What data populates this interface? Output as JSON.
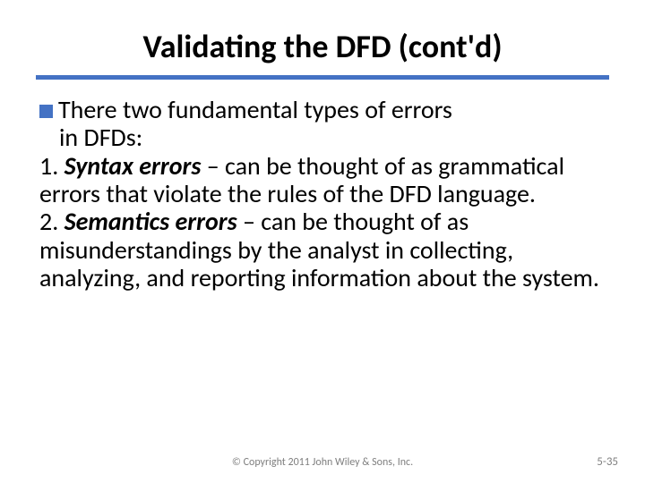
{
  "title": "Validating the DFD (cont'd)",
  "lead": "There two fundamental types of errors",
  "lead_cont": "in DFDs:",
  "item1_num": "1.",
  "item1_term": "Syntax errors",
  "item1_rest": " – can be thought of as grammatical errors that violate the rules of the DFD language.",
  "item2_num": "2.",
  "item2_term": "Semantics errors",
  "item2_rest": " – can be thought of as misunderstandings by the analyst in collecting, analyzing, and reporting information about the system.",
  "copyright": "© Copyright 2011 John Wiley & Sons, Inc.",
  "page": "5-35"
}
